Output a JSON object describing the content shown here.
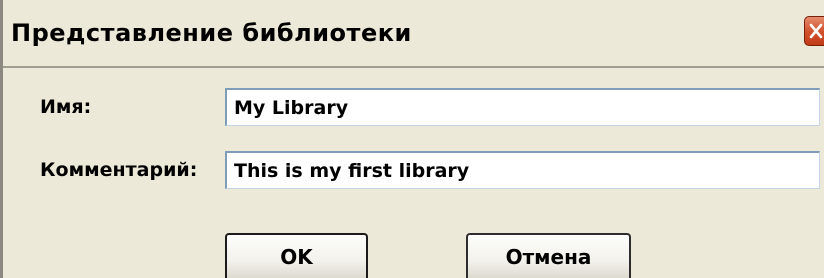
{
  "window": {
    "title": "Представление библиотеки"
  },
  "form": {
    "name_label": "Имя:",
    "name_value": "My Library",
    "comment_label": "Комментарий:",
    "comment_value": "This is my first library"
  },
  "buttons": {
    "ok_label": "OK",
    "cancel_label": "Отмена"
  },
  "icons": {
    "close": "close-icon"
  },
  "colors": {
    "dialog_background": "#ece9d8",
    "close_button": "#d3532f",
    "field_border": "#7f9db9"
  }
}
